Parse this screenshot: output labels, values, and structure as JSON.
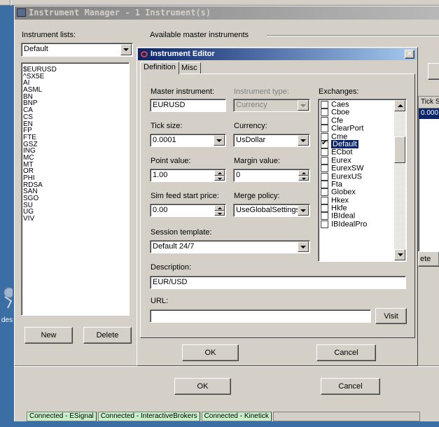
{
  "manager": {
    "title": "Instrument Manager - 1 Instrument(s)",
    "instrument_lists_label": "Instrument lists:",
    "selected_list": "Default",
    "available_master_label": "Available master instruments",
    "instruments": [
      "$EURUSD",
      "^SX5E",
      "AI",
      "ASML",
      "BN",
      "BNP",
      "CA",
      "CS",
      "EN",
      "FP",
      "FTE",
      "GSZ",
      "ING",
      "MC",
      "MT",
      "OR",
      "PHI",
      "RDSA",
      "SAN",
      "SGO",
      "SU",
      "UG",
      "VIV"
    ],
    "new_label": "New",
    "delete_label": "Delete",
    "ok_label": "OK",
    "cancel_label": "Cancel",
    "tick_col_header": "Tick S",
    "tick_col_value": "0.000",
    "partial_button": "ete"
  },
  "editor": {
    "title": "Instrument Editor",
    "close_glyph": "✕",
    "tabs": [
      {
        "label": "Definition"
      },
      {
        "label": "Misc"
      }
    ],
    "master_label": "Master instrument:",
    "master_value": "EURUSD",
    "type_label": "Instrument type:",
    "type_value": "Currency",
    "exchanges_label": "Exchanges:",
    "tick_label": "Tick size:",
    "tick_value": "0.0001",
    "currency_label": "Currency:",
    "currency_value": "UsDollar",
    "point_label": "Point value:",
    "point_value": "1.00",
    "margin_label": "Margin value:",
    "margin_value": "0",
    "sim_label": "Sim feed start price:",
    "sim_value": "0.00",
    "merge_label": "Merge policy:",
    "merge_value": "UseGlobalSettings",
    "session_label": "Session template:",
    "session_value": "Default 24/7",
    "description_label": "Description:",
    "description_value": "EUR/USD",
    "url_label": "URL:",
    "url_value": "",
    "visit_label": "Visit",
    "ok_label": "OK",
    "cancel_label": "Cancel",
    "exchanges": [
      {
        "name": "Caes",
        "checked": false
      },
      {
        "name": "Cboe",
        "checked": false
      },
      {
        "name": "Cfe",
        "checked": false
      },
      {
        "name": "ClearPort",
        "checked": false
      },
      {
        "name": "Cme",
        "checked": false
      },
      {
        "name": "Default",
        "checked": true,
        "selected": true
      },
      {
        "name": "ECbot",
        "checked": false
      },
      {
        "name": "Eurex",
        "checked": false
      },
      {
        "name": "EurexSW",
        "checked": false
      },
      {
        "name": "EurexUS",
        "checked": false
      },
      {
        "name": "Fta",
        "checked": false
      },
      {
        "name": "Globex",
        "checked": false
      },
      {
        "name": "Hkex",
        "checked": false
      },
      {
        "name": "Hkfe",
        "checked": false
      },
      {
        "name": "IBIdeal",
        "checked": false
      },
      {
        "name": "IBIdealPro",
        "checked": false
      }
    ]
  },
  "desktop": {
    "icon_label": "des"
  },
  "status": [
    "Connected - ESignal",
    "Connected - InteractiveBrokers",
    "Connected - Kinetick"
  ]
}
